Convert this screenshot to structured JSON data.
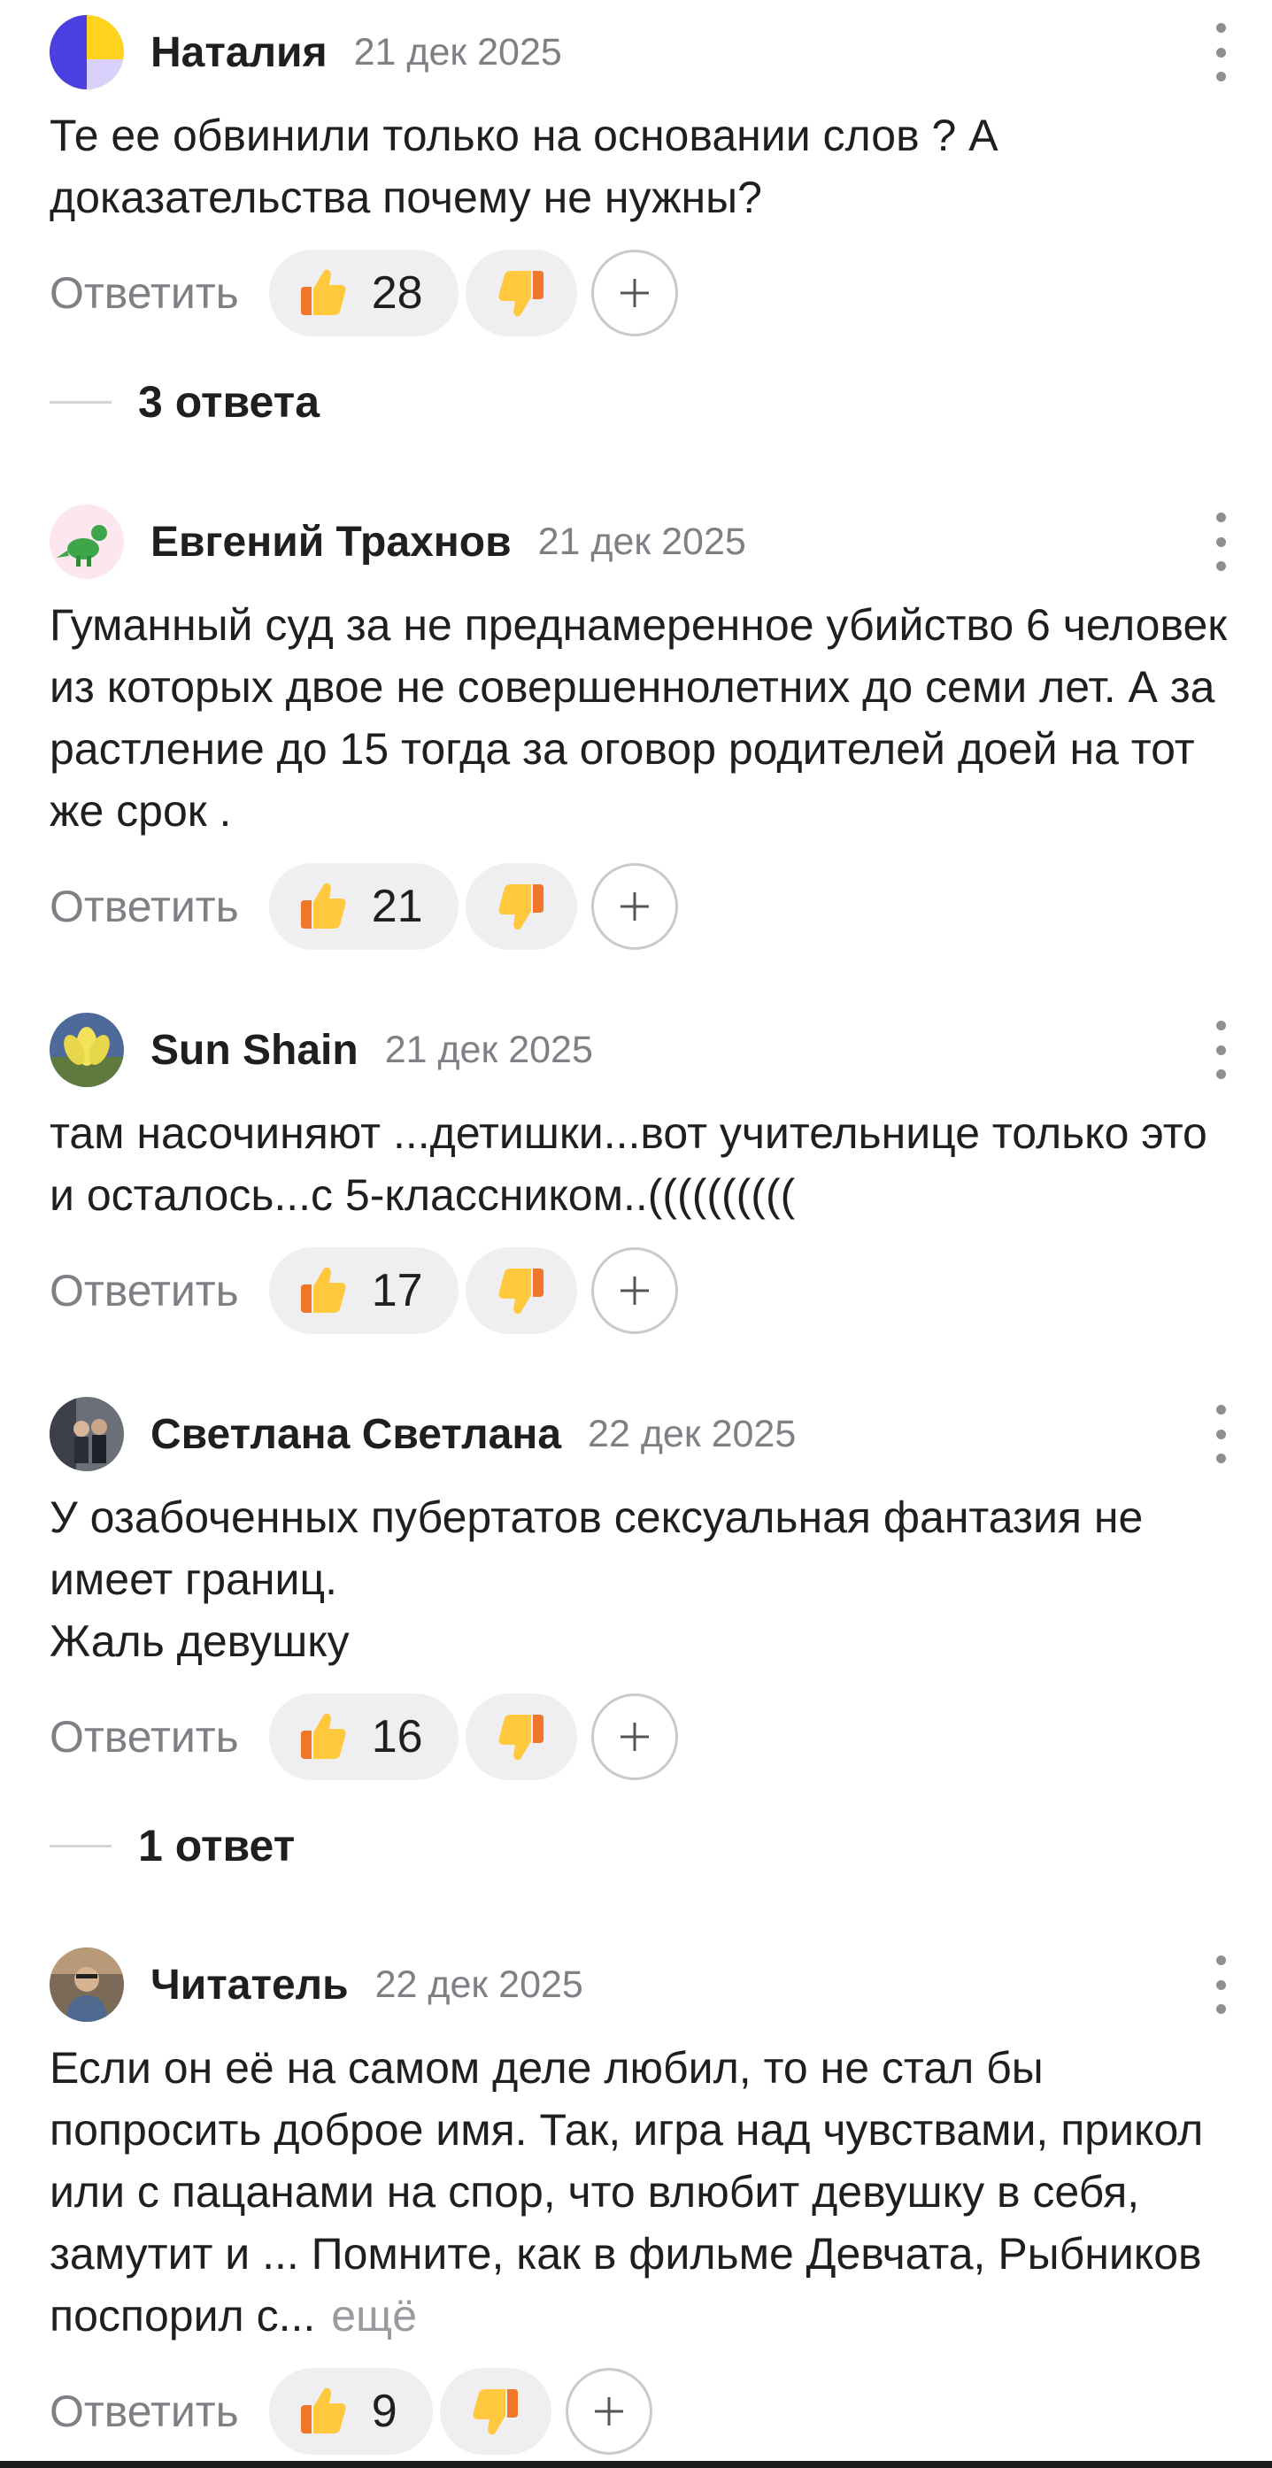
{
  "reply_label": "Ответить",
  "comments": [
    {
      "author": "Наталия",
      "date": "21 дек 2025",
      "lines": [
        "Те ее обвинили только на основании слов ? А доказательства почему не нужны?"
      ],
      "likes": "28",
      "replies_label": "3 ответа"
    },
    {
      "author": "Евгений Трахнов",
      "date": "21 дек 2025",
      "lines": [
        "Гуманный суд за не преднамеренное убийство 6 человек из которых двое не совершеннолетних до семи лет. А за растление до 15 тогда за оговор родителей доей на тот же срок ."
      ],
      "likes": "21"
    },
    {
      "author": "Sun Shain",
      "date": "21 дек 2025",
      "lines": [
        "там насочиняют ...детишки...вот учительнице только это и осталось...с 5-классником..(((((((((("
      ],
      "likes": "17"
    },
    {
      "author": "Светлана Светлана",
      "date": "22 дек 2025",
      "lines": [
        "У озабоченных пубертатов сексуальная фантазия не имеет границ.",
        "Жаль девушку"
      ],
      "likes": "16",
      "replies_label": "1 ответ"
    },
    {
      "author": "Читатель",
      "date": "22 дек 2025",
      "lines": [
        "Если он её на самом деле любил, то не стал бы попросить доброе имя. Так, игра над чувствами, прикол или с пацанами на спор, что влюбит девушку в себя, замутит и ... Помните, как в фильме Девчата, Рыбников поспорил с..."
      ],
      "more_label": "ещё",
      "likes": "9"
    }
  ],
  "icons": {
    "like": "thumbs-up-icon",
    "dislike": "thumbs-down-icon",
    "add_reaction": "plus-icon",
    "menu": "more-vertical-icon"
  },
  "colors": {
    "thumb_yellow": "#ffc83d",
    "thumb_orange": "#f0762a",
    "pill_bg": "#efeff1",
    "muted_text": "#7f7f85"
  }
}
